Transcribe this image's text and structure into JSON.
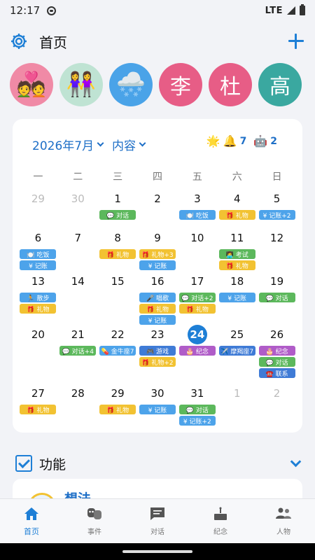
{
  "status": {
    "time": "12:17",
    "network": "LTE"
  },
  "header": {
    "title": "首页",
    "settings_icon": "gear-icon",
    "add_icon": "plus-icon"
  },
  "avatars": [
    {
      "type": "emoji",
      "text": "💑",
      "bg": "#f08aa6"
    },
    {
      "type": "emoji",
      "text": "👭",
      "bg": "#bfe3d3"
    },
    {
      "type": "emoji",
      "text": "🌨️",
      "bg": "#4aa3e8"
    },
    {
      "type": "char",
      "text": "李",
      "bg": "#e75d86"
    },
    {
      "type": "char",
      "text": "杜",
      "bg": "#e75d86"
    },
    {
      "type": "char",
      "text": "高",
      "bg": "#3aa8a0"
    }
  ],
  "calendar": {
    "month_label": "2026年7月",
    "view_label": "内容",
    "weather_icon": "🌟",
    "bell_icon": "🔔",
    "bell_count": "7",
    "robot_icon": "🤖",
    "robot_count": "2",
    "weekdays": [
      "一",
      "二",
      "三",
      "四",
      "五",
      "六",
      "日"
    ],
    "weeks": [
      [
        {
          "d": "29",
          "dim": true,
          "tags": []
        },
        {
          "d": "30",
          "dim": true,
          "tags": []
        },
        {
          "d": "1",
          "tags": [
            {
              "c": "green",
              "t": "💬 对话"
            }
          ]
        },
        {
          "d": "2",
          "tags": []
        },
        {
          "d": "3",
          "tags": [
            {
              "c": "blue",
              "t": "🍽️ 吃饭"
            }
          ]
        },
        {
          "d": "4",
          "tags": [
            {
              "c": "yellow",
              "t": "🎁 礼物"
            }
          ]
        },
        {
          "d": "5",
          "tags": [
            {
              "c": "blue",
              "t": "¥ 记账+2"
            }
          ]
        }
      ],
      [
        {
          "d": "6",
          "tags": [
            {
              "c": "blue",
              "t": "🍽️ 吃饭"
            },
            {
              "c": "blue",
              "t": "¥ 记账"
            }
          ]
        },
        {
          "d": "7",
          "tags": []
        },
        {
          "d": "8",
          "tags": [
            {
              "c": "yellow",
              "t": "🎁 礼物"
            }
          ]
        },
        {
          "d": "9",
          "tags": [
            {
              "c": "yellow",
              "t": "🎁 礼物+3"
            },
            {
              "c": "blue",
              "t": "¥ 记账"
            }
          ]
        },
        {
          "d": "10",
          "tags": []
        },
        {
          "d": "11",
          "tags": [
            {
              "c": "green",
              "t": "👩‍💻 考试"
            },
            {
              "c": "yellow",
              "t": "🎁 礼物"
            }
          ]
        },
        {
          "d": "12",
          "tags": []
        }
      ],
      [
        {
          "d": "13",
          "tags": [
            {
              "c": "blue",
              "t": "🏃 散步"
            },
            {
              "c": "yellow",
              "t": "🎁 礼物"
            }
          ]
        },
        {
          "d": "14",
          "tags": []
        },
        {
          "d": "15",
          "tags": []
        },
        {
          "d": "16",
          "tags": [
            {
              "c": "blue",
              "t": "🎤 唱歌"
            },
            {
              "c": "yellow",
              "t": "🎁 礼物"
            },
            {
              "c": "blue",
              "t": "¥ 记账"
            }
          ]
        },
        {
          "d": "17",
          "tags": [
            {
              "c": "green",
              "t": "💬 对话+2"
            },
            {
              "c": "yellow",
              "t": "🎁 礼物"
            }
          ]
        },
        {
          "d": "18",
          "tags": [
            {
              "c": "blue",
              "t": "¥ 记账"
            }
          ]
        },
        {
          "d": "19",
          "tags": [
            {
              "c": "green",
              "t": "💬 对话"
            }
          ]
        }
      ],
      [
        {
          "d": "20",
          "tags": []
        },
        {
          "d": "21",
          "tags": [
            {
              "c": "green",
              "t": "💬 对话+4"
            }
          ]
        },
        {
          "d": "22",
          "tags": [
            {
              "c": "blue",
              "t": "💊 金牛座7"
            }
          ]
        },
        {
          "d": "23",
          "tags": [
            {
              "c": "dblue",
              "t": "🎮 游戏"
            },
            {
              "c": "yellow",
              "t": "🎁 礼物+2"
            }
          ]
        },
        {
          "d": "24",
          "today": true,
          "tags": [
            {
              "c": "purple",
              "t": "🎂 纪念"
            }
          ]
        },
        {
          "d": "25",
          "tags": [
            {
              "c": "dblue",
              "t": "✈️ 摩羯座7"
            }
          ]
        },
        {
          "d": "26",
          "tags": [
            {
              "c": "purple",
              "t": "🎂 纪念"
            },
            {
              "c": "green",
              "t": "💬 对话"
            },
            {
              "c": "dblue",
              "t": "☎️ 联系"
            }
          ]
        }
      ],
      [
        {
          "d": "27",
          "tags": [
            {
              "c": "yellow",
              "t": "🎁 礼物"
            }
          ]
        },
        {
          "d": "28",
          "tags": []
        },
        {
          "d": "29",
          "tags": [
            {
              "c": "yellow",
              "t": "🎁 礼物"
            }
          ]
        },
        {
          "d": "30",
          "tags": [
            {
              "c": "blue",
              "t": "¥ 记账"
            }
          ]
        },
        {
          "d": "31",
          "tags": [
            {
              "c": "green",
              "t": "💬 对话"
            },
            {
              "c": "blue",
              "t": "¥ 记账+2"
            }
          ]
        },
        {
          "d": "1",
          "dim": true,
          "tags": []
        },
        {
          "d": "2",
          "dim": true,
          "tags": []
        }
      ]
    ]
  },
  "features": {
    "label": "功能",
    "peek_title": "想法"
  },
  "nav": [
    {
      "label": "首页",
      "icon": "home-icon",
      "active": true
    },
    {
      "label": "事件",
      "icon": "masks-icon"
    },
    {
      "label": "对话",
      "icon": "chat-icon"
    },
    {
      "label": "纪念",
      "icon": "cake-icon"
    },
    {
      "label": "人物",
      "icon": "people-icon"
    }
  ],
  "colors": {
    "accent": "#1e7fd6",
    "tag_green": "#5cb85c",
    "tag_blue": "#4da3ea",
    "tag_yellow": "#f2c232",
    "tag_purple": "#b05cc8"
  }
}
